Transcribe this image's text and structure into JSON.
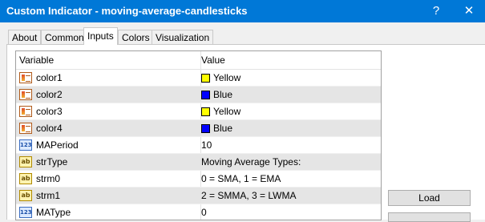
{
  "window": {
    "title": "Custom Indicator - moving-average-candlesticks",
    "help_glyph": "?",
    "close_glyph": "✕"
  },
  "tabs": [
    {
      "label": "About",
      "active": false
    },
    {
      "label": "Common",
      "active": false
    },
    {
      "label": "Inputs",
      "active": true
    },
    {
      "label": "Colors",
      "active": false
    },
    {
      "label": "Visualization",
      "active": false
    }
  ],
  "grid": {
    "columns": [
      "Variable",
      "Value"
    ],
    "rows": [
      {
        "icon": "color-icon",
        "variable": "color1",
        "value": "Yellow",
        "swatch": "#ffff00"
      },
      {
        "icon": "color-icon",
        "variable": "color2",
        "value": "Blue",
        "swatch": "#0000ff"
      },
      {
        "icon": "color-icon",
        "variable": "color3",
        "value": "Yellow",
        "swatch": "#ffff00"
      },
      {
        "icon": "color-icon",
        "variable": "color4",
        "value": "Blue",
        "swatch": "#0000ff"
      },
      {
        "icon": "integer-icon",
        "icon_text": "123",
        "variable": "MAPeriod",
        "value": "10"
      },
      {
        "icon": "string-icon",
        "icon_text": "ab",
        "variable": "strType",
        "value": "Moving Average Types:"
      },
      {
        "icon": "string-icon",
        "icon_text": "ab",
        "variable": "strm0",
        "value": "0 = SMA,  1 = EMA"
      },
      {
        "icon": "string-icon",
        "icon_text": "ab",
        "variable": "strm1",
        "value": "2 = SMMA, 3 = LWMA"
      },
      {
        "icon": "integer-icon",
        "icon_text": "123",
        "variable": "MAType",
        "value": "0"
      }
    ]
  },
  "buttons": {
    "load": "Load"
  },
  "colors": {
    "titlebar": "#0078d7",
    "row_shade": "#e5e5e5"
  }
}
